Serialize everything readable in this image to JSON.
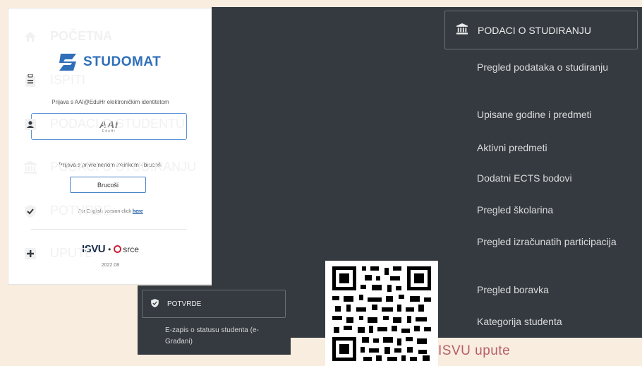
{
  "login": {
    "brand": "STUDOMAT",
    "aai_caption": "Prijava s AAI@EduHr elektroničkim identitetom",
    "aai_button_mark": "AAI",
    "aai_button_sub": "EduHr",
    "temp_caption": "Prijava s privremenom lozinkom - brucoši",
    "brucosi_label": "Brucoši",
    "english_text": "For English version click",
    "english_link": "here",
    "footer_isvu": "ISVU",
    "footer_dot": "•",
    "footer_srce": "srce",
    "version": "2022.08"
  },
  "main_menu": {
    "items": [
      {
        "label": "POČETNA",
        "icon": "home-icon"
      },
      {
        "label": "ISPITI",
        "icon": "clipboard-icon"
      },
      {
        "label": "PODACI O STUDENTU",
        "icon": "id-card-icon"
      },
      {
        "label": "PODACI O STUDIRANJU",
        "icon": "university-icon"
      },
      {
        "label": "POTVRDE",
        "icon": "shield-check-icon"
      },
      {
        "label": "UPUTE",
        "icon": "plus-square-icon"
      }
    ]
  },
  "submenu": {
    "header": "PODACI O STUDIRANJU",
    "items": [
      "Pregled podataka o studiranju",
      "Upisane godine i predmeti",
      "Aktivni predmeti",
      "Dodatni ECTS bodovi",
      "Pregled školarina",
      "Pregled izračunatih participacija",
      "Pregled boravka",
      "Kategorija studenta"
    ]
  },
  "potvrde_panel": {
    "header": "POTVRDE",
    "item": "E-zapis o statusu studenta (e-Građani)"
  },
  "qr": {
    "caption": "ISVU upute"
  },
  "colors": {
    "background": "#f8eddf",
    "dark_panel": "#343a40",
    "brand_blue": "#2f6fba",
    "link_rose": "#b75d6a"
  }
}
